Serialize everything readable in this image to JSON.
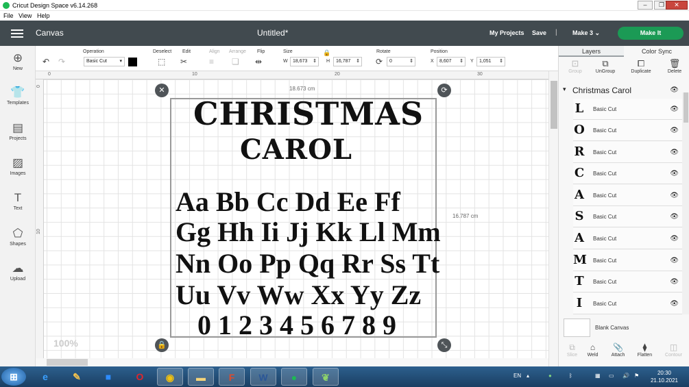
{
  "window": {
    "title": "Cricut Design Space  v6.14.268",
    "controls": [
      "–",
      "❐",
      "✕"
    ]
  },
  "menu": [
    "File",
    "View",
    "Help"
  ],
  "header": {
    "section": "Canvas",
    "doc_title": "Untitled*",
    "my_projects": "My Projects",
    "save": "Save",
    "separator": "|",
    "machine": "Make 3",
    "make_it": "Make It"
  },
  "toolbar": {
    "operation_label": "Operation",
    "operation_value": "Basic Cut",
    "deselect_label": "Deselect",
    "edit_label": "Edit",
    "align_label": "Align",
    "arrange_label": "Arrange",
    "flip_label": "Flip",
    "size_label": "Size",
    "w_label": "W",
    "w_value": "18,673",
    "h_label": "H",
    "h_value": "16,787",
    "rotate_label": "Rotate",
    "rotate_value": "0",
    "position_label": "Position",
    "x_label": "X",
    "x_value": "8,607",
    "y_label": "Y",
    "y_value": "1,051",
    "operation_color": "#000000"
  },
  "leftbar": [
    {
      "label": "New",
      "icon": "plus-circle-icon"
    },
    {
      "label": "Templates",
      "icon": "shirt-icon"
    },
    {
      "label": "Projects",
      "icon": "projects-icon"
    },
    {
      "label": "Images",
      "icon": "image-icon"
    },
    {
      "label": "Text",
      "icon": "text-icon"
    },
    {
      "label": "Shapes",
      "icon": "shapes-icon"
    },
    {
      "label": "Upload",
      "icon": "upload-icon"
    }
  ],
  "canvas": {
    "ruler_top": [
      "0",
      "10",
      "20",
      "30"
    ],
    "ruler_left": [
      "0",
      "10"
    ],
    "width_label": "18.673 cm",
    "height_label": "16.787 cm",
    "zoom": "100%",
    "design_title_line1": "CHRISTMAS",
    "design_title_line2": "CAROL",
    "alphabet_rows": [
      "Aa Bb Cc Dd Ee Ff",
      "Gg Hh Ii Jj Kk Ll Mm",
      "Nn Oo Pp Qq Rr Ss Tt",
      "Uu Vv Ww Xx Yy Zz",
      "0 1 2 3 4 5 6 7 8 9"
    ]
  },
  "right_panel": {
    "tabs": [
      "Layers",
      "Color Sync"
    ],
    "actions": [
      "Group",
      "UnGroup",
      "Duplicate",
      "Delete"
    ],
    "group_name": "Christmas Carol",
    "layers": [
      {
        "glyph": "L",
        "label": "Basic Cut"
      },
      {
        "glyph": "O",
        "label": "Basic Cut"
      },
      {
        "glyph": "R",
        "label": "Basic Cut"
      },
      {
        "glyph": "C",
        "label": "Basic Cut"
      },
      {
        "glyph": "A",
        "label": "Basic Cut"
      },
      {
        "glyph": "S",
        "label": "Basic Cut"
      },
      {
        "glyph": "A",
        "label": "Basic Cut"
      },
      {
        "glyph": "M",
        "label": "Basic Cut"
      },
      {
        "glyph": "T",
        "label": "Basic Cut"
      },
      {
        "glyph": "I",
        "label": "Basic Cut"
      }
    ],
    "blank_canvas": "Blank Canvas",
    "bottom_actions": [
      "Slice",
      "Weld",
      "Attach",
      "Flatten",
      "Contour"
    ]
  },
  "taskbar": {
    "language": "EN",
    "time": "20:30",
    "date": "21.10.2021"
  }
}
